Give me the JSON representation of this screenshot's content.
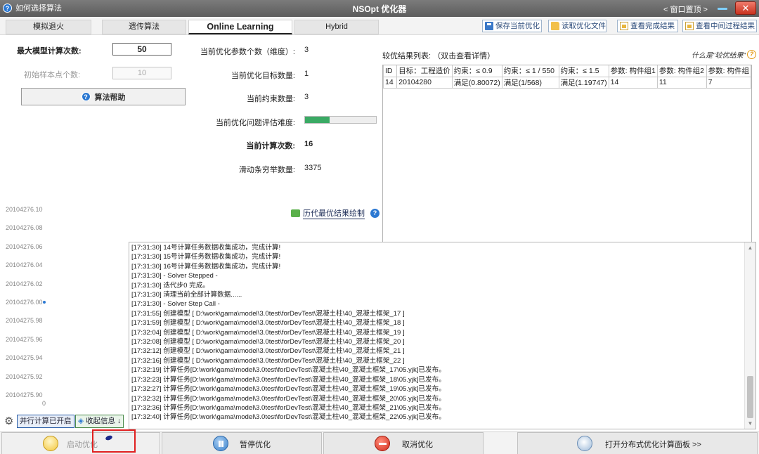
{
  "window": {
    "help_label": "如何选择算法",
    "title": "NSOpt 优化器",
    "restore_label": "< 窗口置顶 >",
    "close_symbol": "✕"
  },
  "tabs": [
    {
      "label": "模拟退火",
      "active": false
    },
    {
      "label": "遗传算法",
      "active": false
    },
    {
      "label": "Online Learning",
      "active": true
    },
    {
      "label": "Hybrid",
      "active": false
    }
  ],
  "toolbar": {
    "save_label": "保存当前优化",
    "load_label": "读取优化文件",
    "view_done_label": "查看完成结果",
    "view_mid_label": "查看中间过程结果"
  },
  "params": {
    "max_iter_label": "最大模型计算次数:",
    "max_iter_value": "50",
    "init_samples_label": "初始样本点个数:",
    "init_samples_value": "10",
    "algo_help_label": "算法帮助"
  },
  "info": {
    "dim_label": "当前优化参数个数（维度）:",
    "dim_value": "3",
    "targets_label": "当前优化目标数量:",
    "targets_value": "1",
    "constraints_label": "当前约束数量:",
    "constraints_value": "3",
    "difficulty_label": "当前优化问题评估难度:",
    "difficulty_fraction": 0.35,
    "current_count_label": "当前计算次数:",
    "current_count_value": "16",
    "slide_label": "滑动条穷举数量:",
    "slide_value": "3375",
    "history_label": "历代最优结果绘制"
  },
  "chart_data": {
    "type": "scatter",
    "yticks": [
      "20104276.10",
      "20104276.08",
      "20104276.06",
      "20104276.04",
      "20104276.02",
      "20104276.00",
      "20104275.98",
      "20104275.96",
      "20104275.94",
      "20104275.92",
      "20104275.90"
    ],
    "xticks": [
      "0"
    ],
    "points": [
      {
        "x": 0,
        "y": 20104276.0
      }
    ]
  },
  "results": {
    "title": "较优结果列表:  （双击查看详情）",
    "what_label": "什么是\"较优结果\"",
    "columns": [
      "ID",
      "目标：工程造价",
      "约束：≤ 0.9",
      "约束：≤ 1 / 550",
      "约束：≤ 1.5",
      "参数: 构件组1",
      "参数: 构件组2",
      "参数: 构件组"
    ],
    "rows": [
      [
        "14",
        "20104280",
        "满足(0.80072)",
        "满足(1/568)",
        "满足(1.19747)",
        "14",
        "11",
        "7"
      ]
    ]
  },
  "log": [
    "[17:31:30] 14号计算任务数据收集成功，完成计算!",
    "[17:31:30] 15号计算任务数据收集成功，完成计算!",
    "[17:31:30] 16号计算任务数据收集成功，完成计算!",
    "[17:31:30]  - Solver Stepped -",
    "[17:31:30] 迭代步0 完成。",
    "[17:31:30] 清理当前全部计算数据......",
    "[17:31:30]  - Solver Step Call -",
    "[17:31:55] 创建模型 [ D:\\work\\gama\\model\\3.0test\\forDevTest\\混凝土柱\\40_混凝土框架_17 ]",
    "[17:31:59] 创建模型 [ D:\\work\\gama\\model\\3.0test\\forDevTest\\混凝土柱\\40_混凝土框架_18 ]",
    "[17:32:04] 创建模型 [ D:\\work\\gama\\model\\3.0test\\forDevTest\\混凝土柱\\40_混凝土框架_19 ]",
    "[17:32:08] 创建模型 [ D:\\work\\gama\\model\\3.0test\\forDevTest\\混凝土柱\\40_混凝土框架_20 ]",
    "[17:32:12] 创建模型 [ D:\\work\\gama\\model\\3.0test\\forDevTest\\混凝土柱\\40_混凝土框架_21 ]",
    "[17:32:16] 创建模型 [ D:\\work\\gama\\model\\3.0test\\forDevTest\\混凝土柱\\40_混凝土框架_22 ]",
    "[17:32:19] 计算任务[D:\\work\\gama\\model\\3.0test\\forDevTest\\混凝土柱\\40_混凝土框架_17\\05.yjk]已发布。",
    "[17:32:23] 计算任务[D:\\work\\gama\\model\\3.0test\\forDevTest\\混凝土柱\\40_混凝土框架_18\\05.yjk]已发布。",
    "[17:32:27] 计算任务[D:\\work\\gama\\model\\3.0test\\forDevTest\\混凝土柱\\40_混凝土框架_19\\05.yjk]已发布。",
    "[17:32:32] 计算任务[D:\\work\\gama\\model\\3.0test\\forDevTest\\混凝土柱\\40_混凝土框架_20\\05.yjk]已发布。",
    "[17:32:36] 计算任务[D:\\work\\gama\\model\\3.0test\\forDevTest\\混凝土柱\\40_混凝土框架_21\\05.yjk]已发布。",
    "[17:32:40] 计算任务[D:\\work\\gama\\model\\3.0test\\forDevTest\\混凝土柱\\40_混凝土框架_22\\05.yjk]已发布。"
  ],
  "bottom": {
    "parallel_label": "并行计算已开启",
    "collapse_label": "收起信息 ↓",
    "start_label": "启动优化",
    "pause_label": "暂停优化",
    "cancel_label": "取消优化",
    "distributed_label": "打开分布式优化计算面板 >>"
  }
}
